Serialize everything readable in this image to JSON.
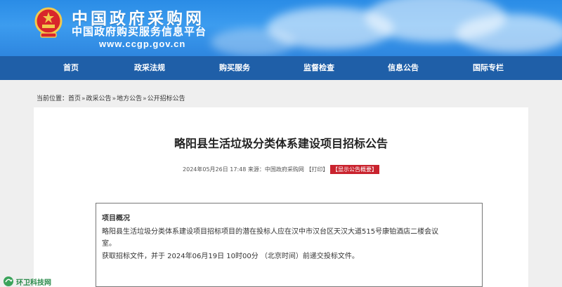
{
  "header": {
    "title": "中国政府采购网",
    "subtitle": "中国政府购买服务信息平台",
    "url": "www.ccgp.gov.cn"
  },
  "nav": {
    "items": [
      "首页",
      "政采法规",
      "购买服务",
      "监督检查",
      "信息公告",
      "国际专栏"
    ]
  },
  "breadcrumb": {
    "prefix": "当前位置：",
    "items": [
      "首页",
      "政采公告",
      "地方公告",
      "公开招标公告"
    ],
    "separator": "»"
  },
  "article": {
    "title": "略阳县生活垃圾分类体系建设项目招标公告",
    "meta_datetime": "2024年05月26日 17:48",
    "meta_source": "来源：中国政府采购网",
    "print_label": "【打印】",
    "summary_label": "【显示公告概要】",
    "box_heading": "项目概况",
    "box_line1": "略阳县生活垃圾分类体系建设项目招标项目的潜在投标人应在汉中市汉台区天汉大道515号康铂酒店二楼会议",
    "box_line2": "室。",
    "box_line3": "获取招标文件，并于 2024年06月19日 10时00分 （北京时间）前递交投标文件。"
  },
  "watermark": {
    "text": "环卫科技网"
  },
  "colors": {
    "nav": "#1f5fa8",
    "banner": "#2a8ce6",
    "summary_button": "#c9232e"
  }
}
